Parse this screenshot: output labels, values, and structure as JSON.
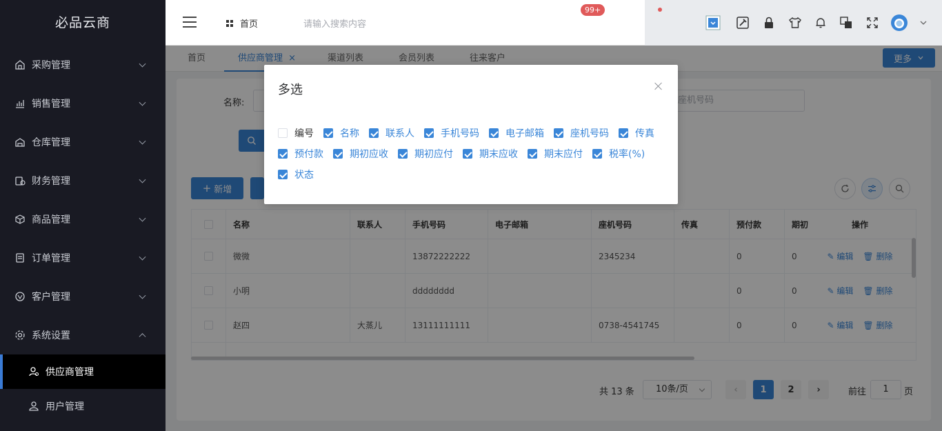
{
  "sidebar": {
    "logo": "必品云商",
    "items": [
      {
        "label": "采购管理",
        "icon": "purchase-icon"
      },
      {
        "label": "销售管理",
        "icon": "chart-icon"
      },
      {
        "label": "仓库管理",
        "icon": "warehouse-icon"
      },
      {
        "label": "财务管理",
        "icon": "finance-icon"
      },
      {
        "label": "商品管理",
        "icon": "box-icon"
      },
      {
        "label": "订单管理",
        "icon": "order-icon"
      },
      {
        "label": "客户管理",
        "icon": "customer-icon"
      },
      {
        "label": "系统设置",
        "icon": "gear-icon"
      }
    ],
    "subitems": [
      {
        "label": "供应商管理",
        "icon": "supplier-icon",
        "active": true
      },
      {
        "label": "用户管理",
        "icon": "user-icon",
        "active": false
      }
    ]
  },
  "header": {
    "home_label": "首页",
    "search_placeholder": "请输入搜索内容",
    "badge": "99+"
  },
  "tabs": [
    {
      "label": "首页"
    },
    {
      "label": "供应商管理",
      "close": "×"
    },
    {
      "label": "渠道列表"
    },
    {
      "label": "会员列表"
    },
    {
      "label": "往来客户"
    }
  ],
  "more_label": "更多",
  "filter": {
    "name_label": "名称:",
    "tel_placeholder": "座机号码"
  },
  "toolbar": {
    "add_label": "新增"
  },
  "table": {
    "headers": [
      "名称",
      "联系人",
      "手机号码",
      "电子邮箱",
      "座机号码",
      "传真",
      "预付款",
      "期初",
      "操作"
    ],
    "rows": [
      [
        "微微",
        "",
        "13872222222",
        "",
        "2345234",
        "",
        "0",
        "0"
      ],
      [
        "小明",
        "",
        "dddddddd",
        "",
        "",
        "",
        "0",
        "0"
      ],
      [
        "赵四",
        "大蒸儿",
        "13111111111",
        "",
        "0738-4541745",
        "",
        "0",
        "0"
      ]
    ],
    "edit_label": "编辑",
    "delete_label": "删除"
  },
  "pagination": {
    "total": "共 13 条",
    "page_size": "10条/页",
    "pages": [
      "1",
      "2"
    ],
    "current": "1",
    "goto_label": "前往",
    "goto_value": "1",
    "page_suffix": "页"
  },
  "modal": {
    "title": "多选",
    "options": [
      {
        "label": "编号",
        "checked": false
      },
      {
        "label": "名称",
        "checked": true
      },
      {
        "label": "联系人",
        "checked": true
      },
      {
        "label": "手机号码",
        "checked": true
      },
      {
        "label": "电子邮箱",
        "checked": true
      },
      {
        "label": "座机号码",
        "checked": true
      },
      {
        "label": "传真",
        "checked": true
      },
      {
        "label": "预付款",
        "checked": true
      },
      {
        "label": "期初应收",
        "checked": true
      },
      {
        "label": "期初应付",
        "checked": true
      },
      {
        "label": "期末应收",
        "checked": true
      },
      {
        "label": "期末应付",
        "checked": true
      },
      {
        "label": "税率(%)",
        "checked": true
      },
      {
        "label": "状态",
        "checked": true
      }
    ]
  },
  "colors": {
    "accent": "#3a86d8",
    "sidebar_bg": "#191a23",
    "badge": "#e05a5a"
  }
}
